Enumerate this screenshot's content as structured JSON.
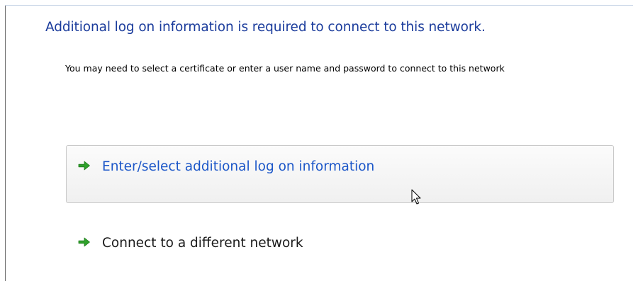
{
  "dialog": {
    "heading": "Additional log on information is required to connect to this network.",
    "description": "You may need to select a certificate or enter a user name and password to connect to this network"
  },
  "options": [
    {
      "label": "Enter/select additional log on information",
      "icon": "green-arrow-icon",
      "state": "hovered"
    },
    {
      "label": "Connect to a different network",
      "icon": "green-arrow-icon",
      "state": "normal"
    }
  ],
  "colors": {
    "heading": "#1b3c9c",
    "link_hover": "#1b56c8",
    "arrow": "#2fa12b"
  }
}
